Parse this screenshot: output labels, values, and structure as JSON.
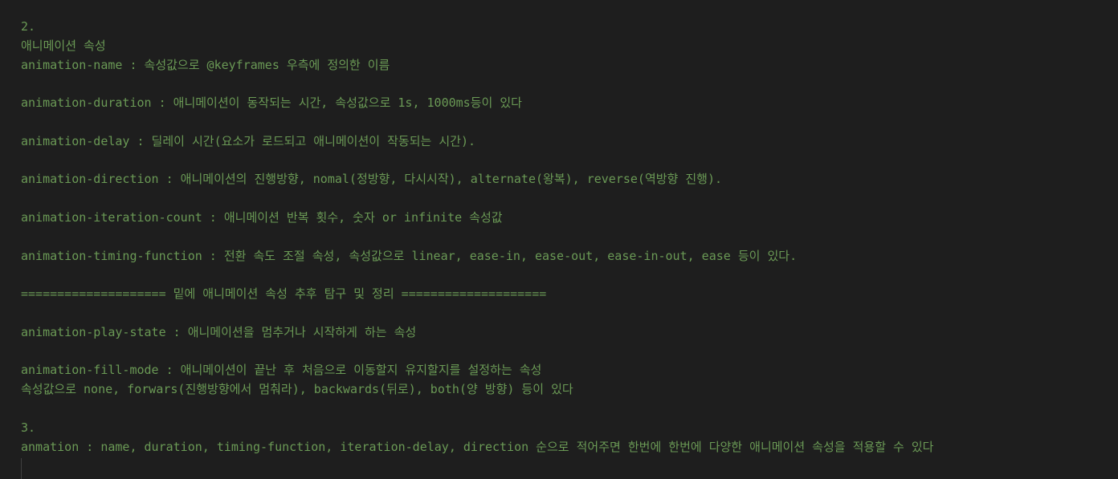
{
  "editor": {
    "lines": [
      "2.",
      "애니메이션 속성",
      "animation-name : 속성값으로 @keyframes 우측에 정의한 이름",
      "",
      "animation-duration : 애니메이션이 동작되는 시간, 속성값으로 1s, 1000ms등이 있다",
      "",
      "animation-delay : 딜레이 시간(요소가 로드되고 애니메이션이 작동되는 시간).",
      "",
      "animation-direction : 애니메이션의 진행방향, nomal(정방향, 다시시작), alternate(왕복), reverse(역방향 진행).",
      "",
      "animation-iteration-count : 애니메이션 반복 횟수, 숫자 or infinite 속성값",
      "",
      "animation-timing-function : 전환 속도 조절 속성, 속성값으로 linear, ease-in, ease-out, ease-in-out, ease 등이 있다.",
      "",
      "==================== 밑에 애니메이션 속성 추후 탐구 및 정리 ====================",
      "",
      "animation-play-state : 애니메이션을 멈추거나 시작하게 하는 속성",
      "",
      "animation-fill-mode : 애니메이션이 끝난 후 처음으로 이동할지 유지할지를 설정하는 속성",
      "속성값으로 none, forwars(진행방향에서 멈춰라), backwards(뒤로), both(양 방향) 등이 있다",
      "",
      "3.",
      "anmation : name, duration, timing-function, iteration-delay, direction 순으로 적어주면 한번에 한번에 다양한 애니메이션 속성을 적용할 수 있다"
    ],
    "text_color": "#6a9955",
    "background": "#1e1e1e"
  }
}
